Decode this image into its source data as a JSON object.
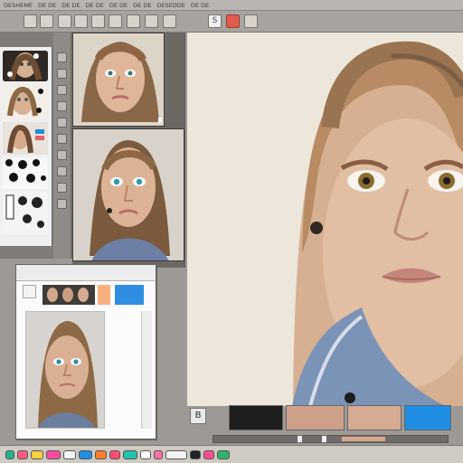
{
  "menu": {
    "items": [
      "DESHEME",
      "DE DE",
      "DE DE",
      "DE DE",
      "DE DE",
      "DE DE",
      "DESEDDE",
      "DE DE"
    ]
  },
  "dialog": {
    "header": "",
    "layer_label": ""
  },
  "bottom_bar": {
    "left_button_label": "B"
  },
  "colors": {
    "accent_blue": "#2e98db",
    "swatch_dark": "#1e1e1e",
    "swatch_skin": "#cea08a",
    "swatch_blue": "#1f8ee2"
  }
}
